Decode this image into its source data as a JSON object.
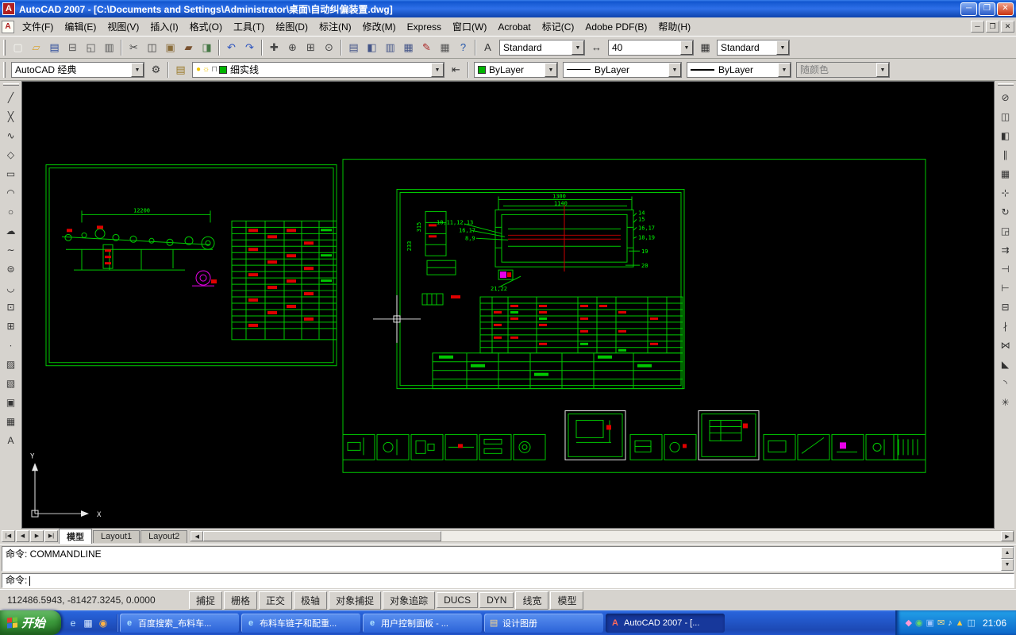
{
  "window": {
    "title": "AutoCAD 2007 - [C:\\Documents and Settings\\Administrator\\桌面\\自动纠偏装置.dwg]",
    "minimize_label": "─",
    "restore_label": "❐",
    "close_label": "✕"
  },
  "glyphs": {
    "logo": "A",
    "doc": "▣",
    "combo_arrow": "▼",
    "gear": "⚙",
    "layer_manager": "▤",
    "layer_previous": "⇤",
    "bulb": "●",
    "sun": "☼",
    "lock": "⊓",
    "text_style": "A",
    "dim_style": "↔",
    "table_style": "▦",
    "scroll_up": "▲",
    "scroll_down": "▼",
    "scroll_left": "◀",
    "scroll_right": "▶",
    "nav_first": "|◀",
    "nav_prev": "◀",
    "nav_next": "▶",
    "nav_last": "▶|"
  },
  "menu": {
    "items": [
      {
        "id": "file",
        "label": "文件(F)"
      },
      {
        "id": "edit",
        "label": "编辑(E)"
      },
      {
        "id": "view",
        "label": "视图(V)"
      },
      {
        "id": "insert",
        "label": "插入(I)"
      },
      {
        "id": "format",
        "label": "格式(O)"
      },
      {
        "id": "tools",
        "label": "工具(T)"
      },
      {
        "id": "draw",
        "label": "绘图(D)"
      },
      {
        "id": "dimension",
        "label": "标注(N)"
      },
      {
        "id": "modify",
        "label": "修改(M)"
      },
      {
        "id": "express",
        "label": "Express"
      },
      {
        "id": "window",
        "label": "窗口(W)"
      },
      {
        "id": "acrobat",
        "label": "Acrobat"
      },
      {
        "id": "markup",
        "label": "标记(C)"
      },
      {
        "id": "adobe-pdf",
        "label": "Adobe PDF(B)"
      },
      {
        "id": "help",
        "label": "帮助(H)"
      }
    ]
  },
  "toolbars": {
    "standard_icons": [
      {
        "name": "qnew-icon",
        "glyph": "▢",
        "color": "#f8f8f4"
      },
      {
        "name": "open-icon",
        "glyph": "▱",
        "color": "#d8a53a"
      },
      {
        "name": "save-icon",
        "glyph": "▤",
        "color": "#2b4b9b"
      },
      {
        "name": "plot-icon",
        "glyph": "⊟",
        "color": "#555555"
      },
      {
        "name": "plot-preview-icon",
        "glyph": "◱",
        "color": "#555555"
      },
      {
        "name": "publish-icon",
        "glyph": "▥",
        "color": "#555555"
      },
      {
        "sep": true
      },
      {
        "name": "cut-icon",
        "glyph": "✂",
        "color": "#444444"
      },
      {
        "name": "copy-icon",
        "glyph": "◫",
        "color": "#444444"
      },
      {
        "name": "paste-icon",
        "glyph": "▣",
        "color": "#8a6d3b"
      },
      {
        "name": "match-properties-icon",
        "glyph": "▰",
        "color": "#7a5230"
      },
      {
        "name": "block-editor-icon",
        "glyph": "◨",
        "color": "#447744"
      },
      {
        "sep": true
      },
      {
        "name": "undo-icon",
        "glyph": "↶",
        "color": "#2a52be"
      },
      {
        "name": "redo-icon",
        "glyph": "↷",
        "color": "#2a52be"
      },
      {
        "sep": true
      },
      {
        "name": "pan-icon",
        "glyph": "✚",
        "color": "#444444"
      },
      {
        "name": "zoom-realtime-icon",
        "glyph": "⊕",
        "color": "#444444"
      },
      {
        "name": "zoom-window-icon",
        "glyph": "⊞",
        "color": "#444444"
      },
      {
        "name": "zoom-previous-icon",
        "glyph": "⊙",
        "color": "#444444"
      },
      {
        "sep": true
      },
      {
        "name": "properties-icon",
        "glyph": "▤",
        "color": "#445588"
      },
      {
        "name": "designcenter-icon",
        "glyph": "◧",
        "color": "#445588"
      },
      {
        "name": "tool-palettes-icon",
        "glyph": "▥",
        "color": "#445588"
      },
      {
        "name": "sheet-set-manager-icon",
        "glyph": "▦",
        "color": "#445588"
      },
      {
        "name": "markup-set-manager-icon",
        "glyph": "✎",
        "color": "#aa2222"
      },
      {
        "name": "quickcalc-icon",
        "glyph": "▦",
        "color": "#555555"
      },
      {
        "name": "help-icon",
        "glyph": "?",
        "color": "#2255aa"
      }
    ],
    "styles": {
      "text_style": "Standard",
      "dim_style": "40",
      "table_style": "Standard"
    },
    "workspace": {
      "value": "AutoCAD 经典"
    },
    "layers": {
      "current_layer": "细实线"
    },
    "properties": {
      "color": "ByLayer",
      "linetype": "ByLayer",
      "lineweight": "ByLayer",
      "plot_style": "随颜色"
    },
    "draw_icons": [
      {
        "name": "line-icon",
        "glyph": "╱"
      },
      {
        "name": "construction-line-icon",
        "glyph": "╳"
      },
      {
        "name": "polyline-icon",
        "glyph": "∿"
      },
      {
        "name": "polygon-icon",
        "glyph": "◇"
      },
      {
        "name": "rectangle-icon",
        "glyph": "▭"
      },
      {
        "name": "arc-icon",
        "glyph": "◠"
      },
      {
        "name": "circle-icon",
        "glyph": "○"
      },
      {
        "name": "revision-cloud-icon",
        "glyph": "☁"
      },
      {
        "name": "spline-icon",
        "glyph": "∼"
      },
      {
        "name": "ellipse-icon",
        "glyph": "⊜"
      },
      {
        "name": "ellipse-arc-icon",
        "glyph": "◡"
      },
      {
        "name": "insert-block-icon",
        "glyph": "⊡"
      },
      {
        "name": "make-block-icon",
        "glyph": "⊞"
      },
      {
        "name": "point-icon",
        "glyph": "∙"
      },
      {
        "name": "hatch-icon",
        "glyph": "▨"
      },
      {
        "name": "gradient-icon",
        "glyph": "▧"
      },
      {
        "name": "region-icon",
        "glyph": "▣"
      },
      {
        "name": "table-icon",
        "glyph": "▦"
      },
      {
        "name": "multiline-text-icon",
        "glyph": "A"
      }
    ],
    "modify_icons": [
      {
        "name": "erase-icon",
        "glyph": "⊘"
      },
      {
        "name": "copy-object-icon",
        "glyph": "◫"
      },
      {
        "name": "mirror-icon",
        "glyph": "◧"
      },
      {
        "name": "offset-icon",
        "glyph": "∥"
      },
      {
        "name": "array-icon",
        "glyph": "▦"
      },
      {
        "name": "move-icon",
        "glyph": "⊹"
      },
      {
        "name": "rotate-icon",
        "glyph": "↻"
      },
      {
        "name": "scale-icon",
        "glyph": "◲"
      },
      {
        "name": "stretch-icon",
        "glyph": "⇉"
      },
      {
        "name": "trim-icon",
        "glyph": "⊣"
      },
      {
        "name": "extend-icon",
        "glyph": "⊢"
      },
      {
        "name": "break-at-point-icon",
        "glyph": "⊟"
      },
      {
        "name": "break-icon",
        "glyph": "∤"
      },
      {
        "name": "join-icon",
        "glyph": "⋈"
      },
      {
        "name": "chamfer-icon",
        "glyph": "◣"
      },
      {
        "name": "fillet-icon",
        "glyph": "◝"
      },
      {
        "name": "explode-icon",
        "glyph": "✳"
      }
    ]
  },
  "tabs": {
    "model": "模型",
    "layout1": "Layout1",
    "layout2": "Layout2"
  },
  "command": {
    "lines": [
      "命令: COMMANDLINE",
      ""
    ],
    "prompt": "命令:"
  },
  "status": {
    "coordinates": "112486.5943, -81427.3245, 0.0000",
    "buttons": [
      {
        "id": "snap",
        "label": "捕捉",
        "pressed": false
      },
      {
        "id": "grid",
        "label": "栅格",
        "pressed": false
      },
      {
        "id": "ortho",
        "label": "正交",
        "pressed": false
      },
      {
        "id": "polar",
        "label": "极轴",
        "pressed": false
      },
      {
        "id": "osnap",
        "label": "对象捕捉",
        "pressed": false
      },
      {
        "id": "otrack",
        "label": "对象追踪",
        "pressed": false
      },
      {
        "id": "ducs",
        "label": "DUCS",
        "pressed": false
      },
      {
        "id": "dyn",
        "label": "DYN",
        "pressed": false
      },
      {
        "id": "lwt",
        "label": "线宽",
        "pressed": false
      },
      {
        "id": "model",
        "label": "模型",
        "pressed": false
      }
    ]
  },
  "taskbar": {
    "start_label": "开始",
    "quick_launch": [
      {
        "name": "quicklaunch-ie-icon",
        "glyph": "e",
        "color": "#bfe3ff"
      },
      {
        "name": "quicklaunch-show-desktop-icon",
        "glyph": "▦",
        "color": "#d8e8ff"
      },
      {
        "name": "quicklaunch-media-icon",
        "glyph": "◉",
        "color": "#ffb347"
      }
    ],
    "tasks": [
      {
        "id": "baidu-search",
        "icon": "ie",
        "icon_glyph": "e",
        "icon_color": "#aee2ff",
        "label": "百度搜索_布料车...",
        "active": false
      },
      {
        "id": "buliaoche-page",
        "icon": "ie",
        "icon_glyph": "e",
        "icon_color": "#aee2ff",
        "label": "布料车链子和配重...",
        "active": false
      },
      {
        "id": "user-panel",
        "icon": "ie",
        "icon_glyph": "e",
        "icon_color": "#aee2ff",
        "label": "用户控制面板 - ...",
        "active": false
      },
      {
        "id": "design-album",
        "icon": "folder",
        "icon_glyph": "▤",
        "icon_color": "#ffd98a",
        "label": "设计图册",
        "active": false
      },
      {
        "id": "autocad",
        "icon": "acad",
        "icon_glyph": "A",
        "icon_color": "#ff6a5a",
        "label": "AutoCAD 2007 - [...",
        "active": true
      }
    ],
    "tray_icons": [
      {
        "name": "tray-pink-icon",
        "glyph": "◆",
        "color": "#ff9ad5"
      },
      {
        "name": "tray-green-icon",
        "glyph": "◉",
        "color": "#68d968"
      },
      {
        "name": "tray-blue-icon",
        "glyph": "▣",
        "color": "#9cc4ff"
      },
      {
        "name": "tray-mail-icon",
        "glyph": "✉",
        "color": "#ffe08a"
      },
      {
        "name": "tray-sound-icon",
        "glyph": "♪",
        "color": "#d8e8ff"
      },
      {
        "name": "tray-shield-icon",
        "glyph": "▲",
        "color": "#ffcc44"
      },
      {
        "name": "tray-net-icon",
        "glyph": "◫",
        "color": "#bfe3ff"
      }
    ],
    "time": "21:06"
  },
  "drawing": {
    "dims": {
      "left_length": "12200",
      "overall": "1300",
      "inner": "1140",
      "height": "315",
      "width2": "233"
    },
    "callouts": {
      "c1": "10,11,12,13",
      "c2": "16,17",
      "c3": "8,9",
      "c4": "14",
      "c5": "15",
      "c6": "16,17",
      "c7": "18,19",
      "c8": "19",
      "c9": "20",
      "c10": "21,22"
    },
    "ucs": {
      "x_label": "X",
      "y_label": "Y"
    }
  }
}
